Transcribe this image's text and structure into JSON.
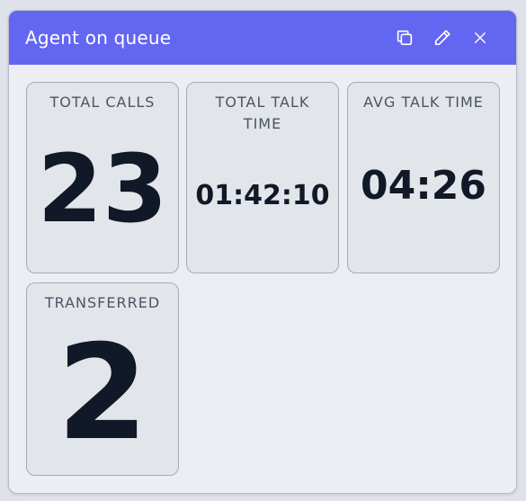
{
  "widget": {
    "title": "Agent on queue",
    "actions": [
      {
        "name": "copy-icon"
      },
      {
        "name": "pencil-icon"
      },
      {
        "name": "close-icon"
      }
    ]
  },
  "stats": {
    "total_calls": {
      "label": "TOTAL CALLS",
      "value": "23"
    },
    "total_talk_time": {
      "label": "TOTAL TALK TIME",
      "value": "01:42:10"
    },
    "avg_talk_time": {
      "label": "AVG TALK TIME",
      "value": "04:26"
    },
    "transferred": {
      "label": "TRANSFERRED",
      "value": "2"
    }
  },
  "colors": {
    "header": "#6366f1",
    "panel": "#eceef3",
    "card": "#e2e5ea",
    "value_text": "#111827",
    "label_text": "#4b5563"
  }
}
